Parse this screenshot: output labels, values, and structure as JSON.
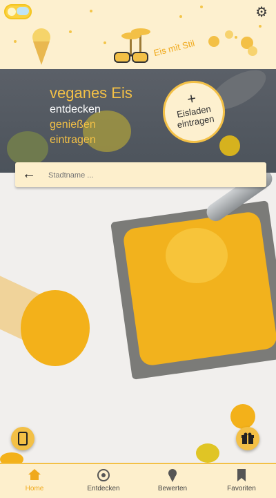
{
  "header": {
    "logo_text": "Eis mit Stil",
    "settings_icon": "gear-icon",
    "theme_toggle_icon": "sun-cloud-icon"
  },
  "hero": {
    "title": "veganes Eis",
    "line1": "entdecken",
    "line2": "genießen",
    "line3": "eintragen",
    "add_shop_plus": "+",
    "add_shop_label_1": "Eisladen",
    "add_shop_label_2": "eintragen"
  },
  "search": {
    "placeholder": "Stadtname ...",
    "value": "",
    "back_icon": "arrow-left-icon"
  },
  "fabs": {
    "left_icon": "phone-icon",
    "right_icon": "gift-icon"
  },
  "nav": {
    "items": [
      {
        "label": "Home",
        "icon": "home-icon",
        "active": true
      },
      {
        "label": "Entdecken",
        "icon": "target-icon",
        "active": false
      },
      {
        "label": "Bewerten",
        "icon": "ice-cream-icon",
        "active": false
      },
      {
        "label": "Favoriten",
        "icon": "bookmark-icon",
        "active": false
      }
    ]
  },
  "colors": {
    "accent": "#f3c046",
    "header_bg": "#fdf0cf",
    "hero_bg": "#555b63",
    "active_nav": "#f0a91b"
  }
}
